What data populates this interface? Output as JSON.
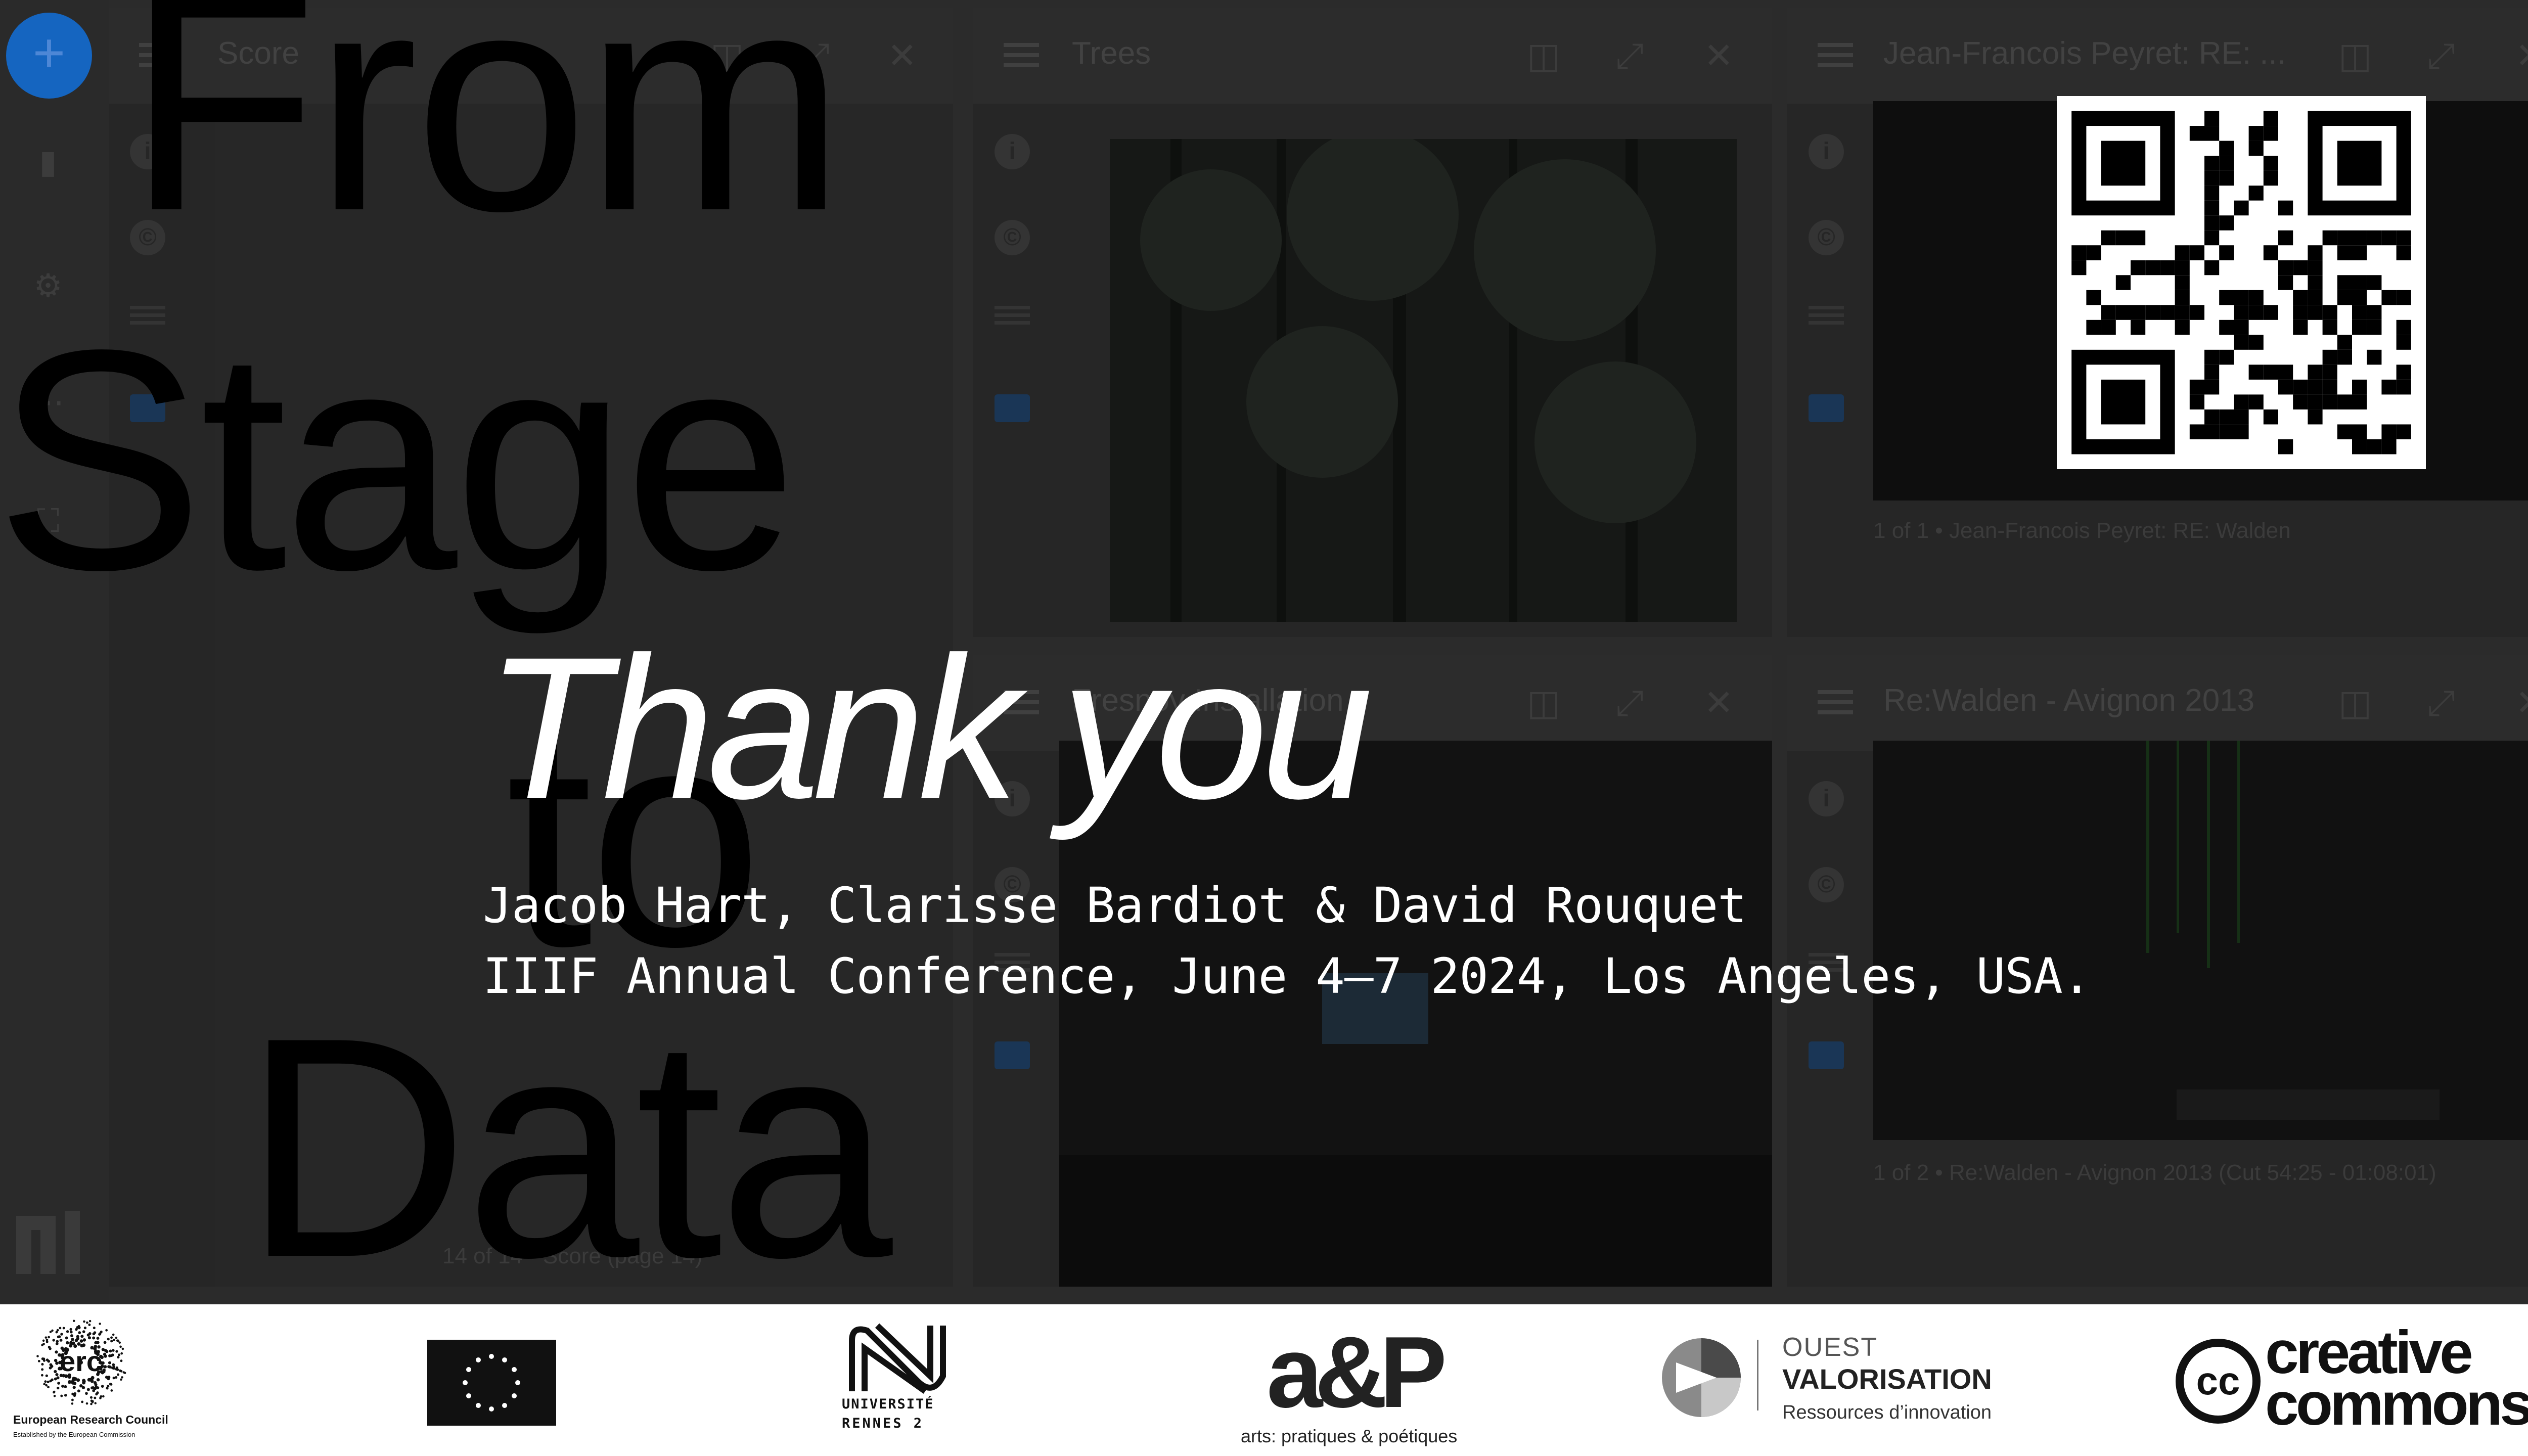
{
  "windows": [
    {
      "title": "Score",
      "caption": "14 of 14 • Score (page 14)"
    },
    {
      "title": "Trees",
      "caption": ""
    },
    {
      "title": "Jean-Francois Peyret: RE: ...",
      "caption": "1 of 1 • Jean-Francois Peyret: RE: Walden"
    },
    {
      "title": "Fresnoy Installation",
      "caption": ""
    },
    {
      "title": "Re:Walden - Avignon 2013",
      "caption": "1 of 2 • Re:Walden - Avignon 2013 (Cut 54:25 - 01:08:01)"
    }
  ],
  "background_words": [
    "From",
    "Stage",
    "to",
    "Data"
  ],
  "slide": {
    "heading": "Thank you",
    "authors": "Jacob Hart, Clarisse Bardiot & David Rouquet",
    "event": "IIIF Annual Conference, June 4–7 2024, Los Angeles, USA."
  },
  "icons": {
    "add": "plus-icon",
    "close": "close-icon",
    "info": "info-icon",
    "rights": "copyright-icon",
    "index": "list-icon",
    "annotations": "comment-icon"
  },
  "footer": {
    "erc": {
      "name": "European Research Council",
      "sub": "Established by the European Commission",
      "mark": "erc"
    },
    "eu_flag": {
      "colors": [
        "#1f3a93",
        "#f5d400"
      ]
    },
    "rennes": {
      "line1": "UNIVERSITÉ",
      "line2": "RENNES 2"
    },
    "app": {
      "mark": "a&P",
      "tag": "arts: pratiques & poétiques"
    },
    "ouest": {
      "line1": "OUEST",
      "line2": "VALORISATION",
      "line3": "Ressources d’innovation"
    },
    "cc": {
      "mark": "cc",
      "line1": "creative",
      "line2": "commons"
    }
  },
  "colors": {
    "accent": "#1565c0",
    "slide_bg": "#2b2b2b",
    "text": "#ffffff"
  }
}
